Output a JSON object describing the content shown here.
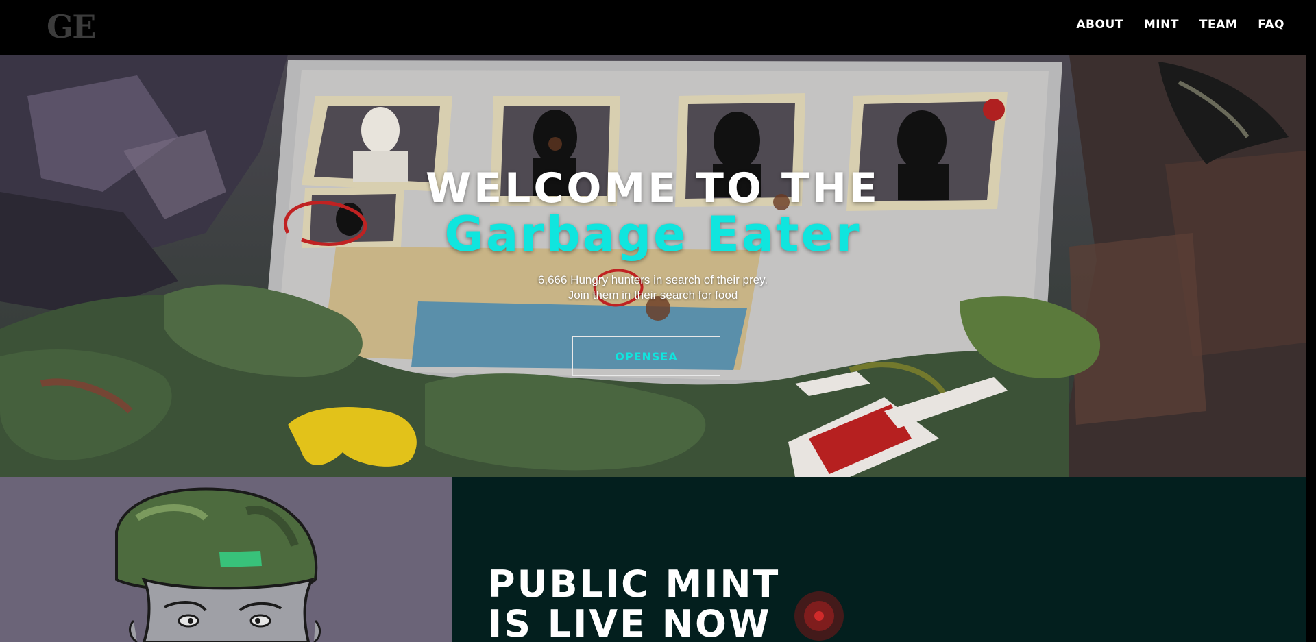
{
  "nav": {
    "logo": "GE",
    "links": [
      {
        "label": "ABOUT"
      },
      {
        "label": "MINT"
      },
      {
        "label": "TEAM"
      },
      {
        "label": "FAQ"
      }
    ]
  },
  "hero": {
    "title": "WELCOME TO THE",
    "subtitle": "Garbage Eater",
    "description_line1": "6,666 Hungry hunters in search of their prey.",
    "description_line2": "Join them in their search for food",
    "button_label": "OPENSEA"
  },
  "mint": {
    "title_line1": "PUBLIC MINT",
    "title_line2": "IS LIVE NOW"
  },
  "colors": {
    "accent": "#10e5de",
    "nav_bg": "#000000",
    "mint_bg": "#031f1e",
    "panel_bg": "#6b6478"
  }
}
